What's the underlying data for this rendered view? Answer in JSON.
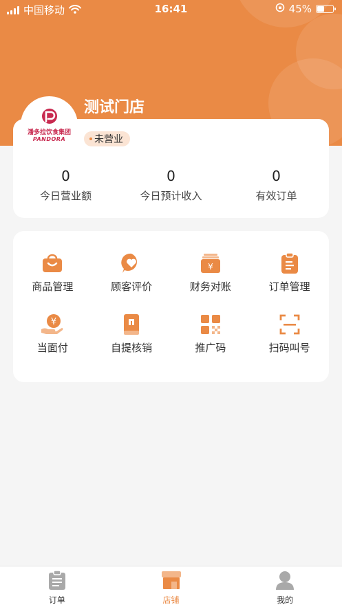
{
  "status_bar": {
    "carrier": "中国移动",
    "time": "16:41",
    "battery_percent": "45%",
    "battery_level": 0.45
  },
  "store": {
    "name": "测试门店",
    "logo_text_cn": "潘多拉饮食集团",
    "logo_text_en": "PANDORA",
    "status": "未营业"
  },
  "stats": [
    {
      "value": "0",
      "label": "今日营业额"
    },
    {
      "value": "0",
      "label": "今日预计收入"
    },
    {
      "value": "0",
      "label": "有效订单"
    }
  ],
  "menu": [
    {
      "label": "商品管理",
      "icon": "basket-icon"
    },
    {
      "label": "顾客评价",
      "icon": "heart-chat-icon"
    },
    {
      "label": "财务对账",
      "icon": "yuan-box-icon"
    },
    {
      "label": "订单管理",
      "icon": "clipboard-icon"
    },
    {
      "label": "当面付",
      "icon": "hand-yuan-icon"
    },
    {
      "label": "自提核销",
      "icon": "book-icon"
    },
    {
      "label": "推广码",
      "icon": "qr-code-icon"
    },
    {
      "label": "扫码叫号",
      "icon": "scan-icon"
    }
  ],
  "tabs": [
    {
      "label": "订单",
      "icon": "order-doc-icon",
      "active": false
    },
    {
      "label": "店铺",
      "icon": "store-icon",
      "active": true
    },
    {
      "label": "我的",
      "icon": "profile-icon",
      "active": false
    }
  ],
  "colors": {
    "accent": "#ea8a45",
    "badge_bg": "#fbe4d4",
    "logo": "#c8294f"
  }
}
